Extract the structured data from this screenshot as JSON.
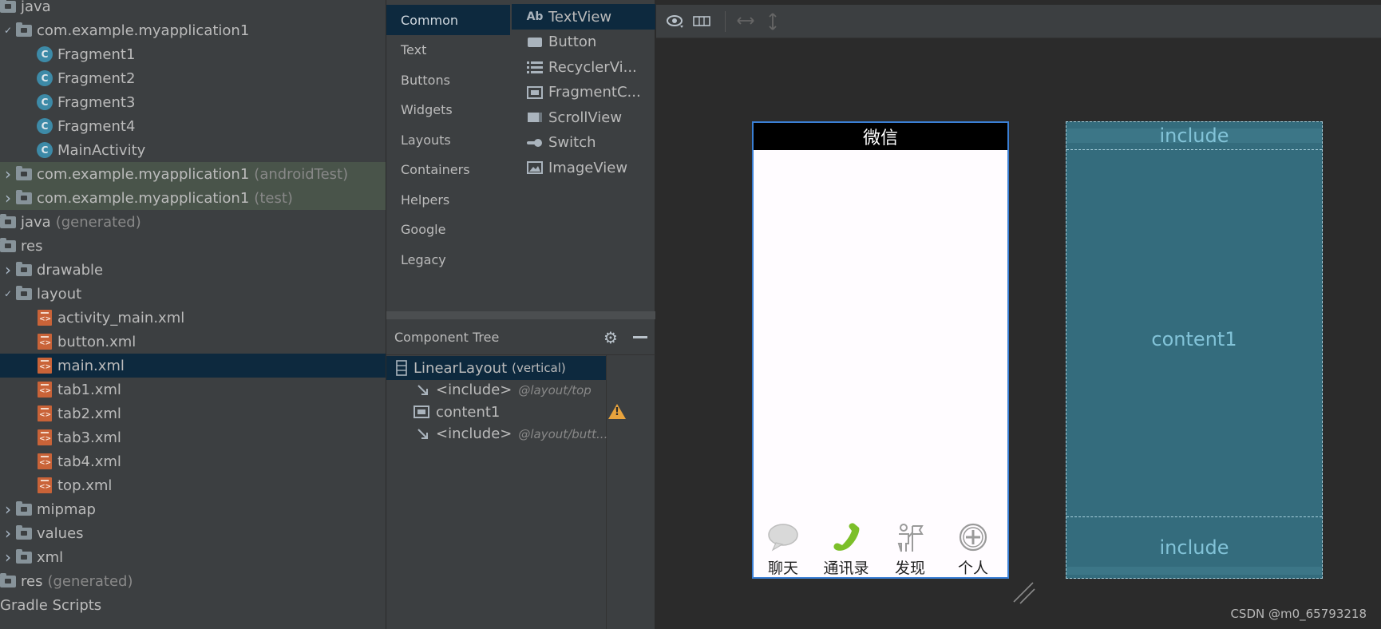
{
  "project_tree": [
    {
      "label": "java",
      "icon": "folder-icon",
      "arrow": "",
      "depth": 0,
      "state": "",
      "suffix": ""
    },
    {
      "label": "com.example.myapplication1",
      "icon": "package-folder-icon",
      "arrow": "expanded",
      "depth": 1,
      "state": "",
      "suffix": ""
    },
    {
      "label": "Fragment1",
      "icon": "class-icon",
      "arrow": "",
      "depth": 2,
      "state": "",
      "suffix": ""
    },
    {
      "label": "Fragment2",
      "icon": "class-icon",
      "arrow": "",
      "depth": 2,
      "state": "",
      "suffix": ""
    },
    {
      "label": "Fragment3",
      "icon": "class-icon",
      "arrow": "",
      "depth": 2,
      "state": "",
      "suffix": ""
    },
    {
      "label": "Fragment4",
      "icon": "class-icon",
      "arrow": "",
      "depth": 2,
      "state": "",
      "suffix": ""
    },
    {
      "label": "MainActivity",
      "icon": "class-icon",
      "arrow": "",
      "depth": 2,
      "state": "",
      "suffix": ""
    },
    {
      "label": "com.example.myapplication1",
      "icon": "package-folder-icon",
      "arrow": "collapsed",
      "depth": 1,
      "state": "test",
      "suffix": "(androidTest)"
    },
    {
      "label": "com.example.myapplication1",
      "icon": "package-folder-icon",
      "arrow": "collapsed",
      "depth": 1,
      "state": "test",
      "suffix": "(test)"
    },
    {
      "label": "java",
      "icon": "generated-folder-icon",
      "arrow": "",
      "depth": 0,
      "state": "",
      "suffix": "(generated)"
    },
    {
      "label": "res",
      "icon": "res-folder-icon",
      "arrow": "",
      "depth": 0,
      "state": "",
      "suffix": ""
    },
    {
      "label": "drawable",
      "icon": "folder-icon",
      "arrow": "collapsed",
      "depth": 1,
      "state": "",
      "suffix": ""
    },
    {
      "label": "layout",
      "icon": "folder-icon",
      "arrow": "expanded",
      "depth": 1,
      "state": "",
      "suffix": ""
    },
    {
      "label": "activity_main.xml",
      "icon": "layout-xml-icon",
      "arrow": "",
      "depth": 2,
      "state": "",
      "suffix": ""
    },
    {
      "label": "button.xml",
      "icon": "layout-xml-icon",
      "arrow": "",
      "depth": 2,
      "state": "",
      "suffix": ""
    },
    {
      "label": "main.xml",
      "icon": "layout-xml-icon",
      "arrow": "",
      "depth": 2,
      "state": "selected",
      "suffix": ""
    },
    {
      "label": "tab1.xml",
      "icon": "layout-xml-icon",
      "arrow": "",
      "depth": 2,
      "state": "",
      "suffix": ""
    },
    {
      "label": "tab2.xml",
      "icon": "layout-xml-icon",
      "arrow": "",
      "depth": 2,
      "state": "",
      "suffix": ""
    },
    {
      "label": "tab3.xml",
      "icon": "layout-xml-icon",
      "arrow": "",
      "depth": 2,
      "state": "",
      "suffix": ""
    },
    {
      "label": "tab4.xml",
      "icon": "layout-xml-icon",
      "arrow": "",
      "depth": 2,
      "state": "",
      "suffix": ""
    },
    {
      "label": "top.xml",
      "icon": "layout-xml-icon",
      "arrow": "",
      "depth": 2,
      "state": "",
      "suffix": ""
    },
    {
      "label": "mipmap",
      "icon": "folder-icon",
      "arrow": "collapsed",
      "depth": 1,
      "state": "",
      "suffix": ""
    },
    {
      "label": "values",
      "icon": "folder-icon",
      "arrow": "collapsed",
      "depth": 1,
      "state": "",
      "suffix": ""
    },
    {
      "label": "xml",
      "icon": "folder-icon",
      "arrow": "collapsed",
      "depth": 1,
      "state": "",
      "suffix": ""
    },
    {
      "label": "res",
      "icon": "res-folder-icon",
      "arrow": "",
      "depth": 0,
      "state": "",
      "suffix": "(generated)"
    },
    {
      "label": "Gradle Scripts",
      "icon": "",
      "arrow": "",
      "depth": 0,
      "state": "",
      "suffix": ""
    }
  ],
  "palette": {
    "categories": [
      "Common",
      "Text",
      "Buttons",
      "Widgets",
      "Layouts",
      "Containers",
      "Helpers",
      "Google",
      "Legacy"
    ],
    "selected_category": "Common",
    "components": [
      {
        "label": "TextView",
        "icon": "textview-icon",
        "glyph": "Ab"
      },
      {
        "label": "Button",
        "icon": "button-icon",
        "glyph": ""
      },
      {
        "label": "RecyclerVi...",
        "icon": "recyclerview-icon",
        "glyph": ""
      },
      {
        "label": "FragmentC...",
        "icon": "fragmentcontainer-icon",
        "glyph": ""
      },
      {
        "label": "ScrollView",
        "icon": "scrollview-icon",
        "glyph": ""
      },
      {
        "label": "Switch",
        "icon": "switch-icon",
        "glyph": ""
      },
      {
        "label": "ImageView",
        "icon": "imageview-icon",
        "glyph": ""
      }
    ]
  },
  "component_tree": {
    "title": "Component Tree",
    "rows": [
      {
        "label": "LinearLayout",
        "extra": "(vertical)",
        "sub": "",
        "icon": "linearlayout-icon",
        "depth": 0,
        "selected": true,
        "warning": false
      },
      {
        "label": "<include>",
        "extra": "",
        "sub": "@layout/top",
        "icon": "include-icon",
        "depth": 1,
        "selected": false,
        "warning": false
      },
      {
        "label": "content1",
        "extra": "",
        "sub": "",
        "icon": "framelayout-icon",
        "depth": 1,
        "selected": false,
        "warning": true
      },
      {
        "label": "<include>",
        "extra": "",
        "sub": "@layout/butt...",
        "icon": "include-icon",
        "depth": 1,
        "selected": false,
        "warning": false
      }
    ]
  },
  "design": {
    "phone_title": "微信",
    "tabs": [
      {
        "label": "聊天",
        "icon": "chat-bubble-icon"
      },
      {
        "label": "通讯录",
        "icon": "phone-icon"
      },
      {
        "label": "发现",
        "icon": "discover-icon"
      },
      {
        "label": "个人",
        "icon": "add-circle-icon"
      }
    ],
    "blueprint": {
      "top": "include",
      "middle": "content1",
      "bottom": "include"
    }
  },
  "watermark": "CSDN @m0_65793218",
  "colors": {
    "selection": "#0d293e",
    "test_folder": "#49544a",
    "blueprint": "#346c7d",
    "accent_green": "#7cbf2a"
  }
}
